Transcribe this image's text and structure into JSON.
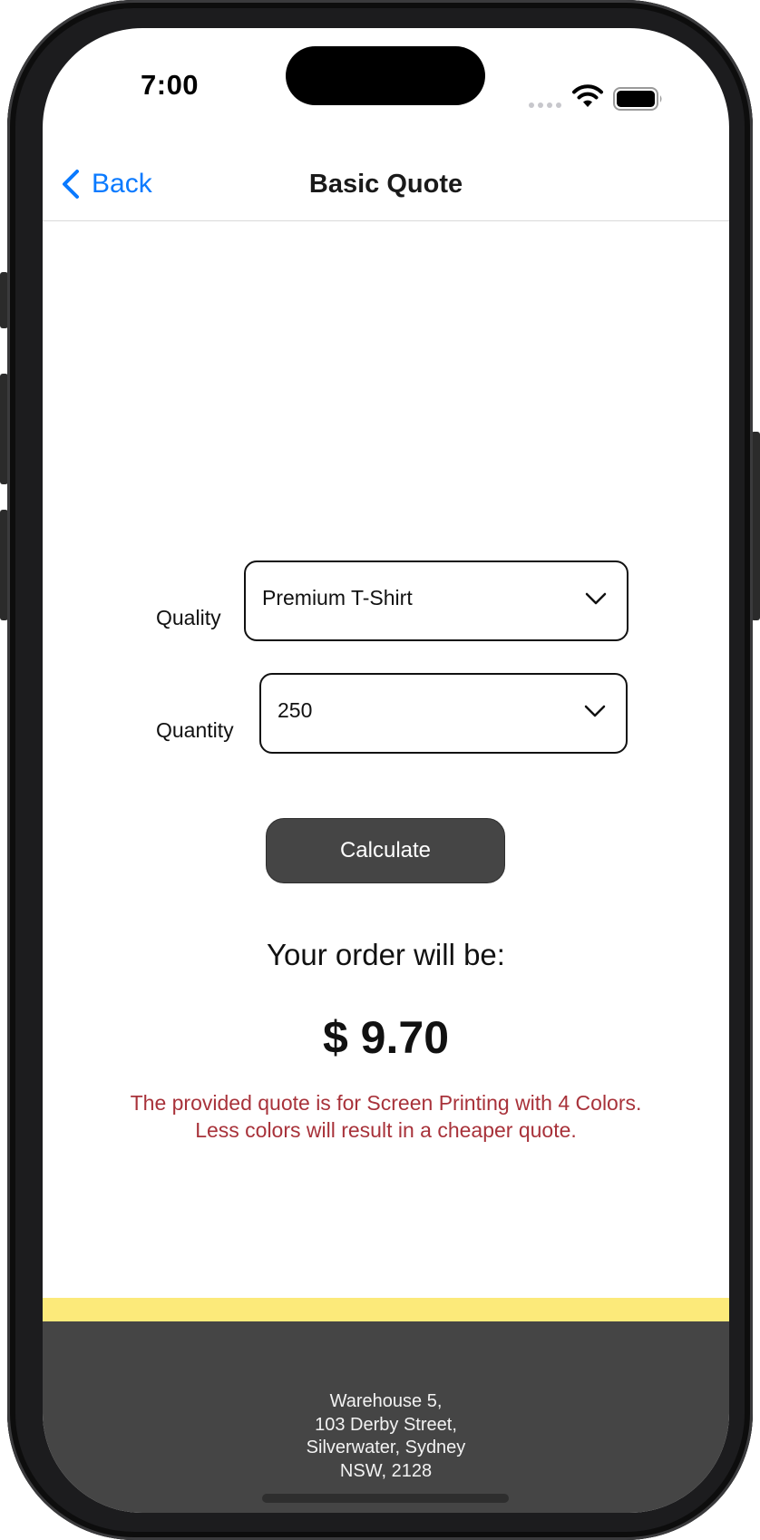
{
  "status_bar": {
    "time": "7:00"
  },
  "nav": {
    "back_label": "Back",
    "title": "Basic Quote"
  },
  "form": {
    "quality": {
      "label": "Quality",
      "selected": "Premium T-Shirt"
    },
    "quantity": {
      "label": "Quantity",
      "selected": "250"
    },
    "calculate_label": "Calculate"
  },
  "result": {
    "heading": "Your order will be:",
    "price": "$ 9.70",
    "note_line1": "The provided quote is for Screen Printing with 4 Colors.",
    "note_line2": "Less colors will result in a cheaper quote."
  },
  "footer": {
    "address_line1": "Warehouse 5,",
    "address_line2": "103 Derby Street,",
    "address_line3": "Silverwater, Sydney",
    "address_line4": "NSW, 2128"
  },
  "colors": {
    "accent_link": "#0a7aff",
    "button_bg": "#454545",
    "note_text": "#a8323a",
    "footer_stripe": "#fcea7a",
    "footer_bg": "#454545"
  },
  "icons": {
    "back": "chevron-left-icon",
    "dropdown": "chevron-down-icon",
    "wifi": "wifi-icon",
    "battery": "battery-icon",
    "signal": "signal-icon"
  }
}
